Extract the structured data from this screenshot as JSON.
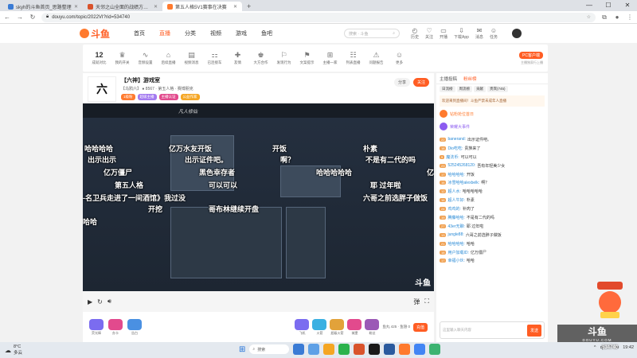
{
  "browser": {
    "tabs": [
      {
        "title": "skyh的斗鱼首页_思路整理",
        "color": "#3a7bd5",
        "active": false
      },
      {
        "title": "天邻之山全面的战绩方一套 企",
        "color": "#d9532c",
        "active": false
      },
      {
        "title": "第五人格5V1赛事在决赛",
        "color": "#ff7a2e",
        "active": true
      }
    ],
    "new_tab": "+",
    "url": "douyu.com/topic/2022VI?rid=534740",
    "controls": [
      "—",
      "☐",
      "✕"
    ]
  },
  "site": {
    "logo": "斗鱼",
    "nav": [
      {
        "label": "首页",
        "active": false
      },
      {
        "label": "直播",
        "active": true
      },
      {
        "label": "分类",
        "active": false
      },
      {
        "label": "视频",
        "active": false
      },
      {
        "label": "游戏",
        "active": false
      },
      {
        "label": "鱼吧",
        "active": false
      }
    ],
    "search_placeholder": "搜索 · 斗鱼",
    "top_icons": [
      {
        "icon": "◴",
        "label": "历史"
      },
      {
        "icon": "♡",
        "label": "关注"
      },
      {
        "icon": "▭",
        "label": "开播"
      },
      {
        "icon": "⇩",
        "label": "下载App"
      },
      {
        "icon": "✉",
        "label": "消息"
      },
      {
        "icon": "☺",
        "label": "任务"
      }
    ]
  },
  "toolrow": {
    "items": [
      {
        "icon": "12",
        "label": "成就对比"
      },
      {
        "icon": "♛",
        "label": "我的开关"
      },
      {
        "icon": "∿",
        "label": "音频设置"
      },
      {
        "icon": "⌂",
        "label": "后续直播"
      },
      {
        "icon": "▤",
        "label": "视频消息"
      },
      {
        "icon": "⚏",
        "label": "已连接车"
      },
      {
        "icon": "✚",
        "label": "友情"
      },
      {
        "icon": "♚",
        "label": "大方合作"
      },
      {
        "icon": "⚐",
        "label": "发现行为"
      },
      {
        "icon": "⚑",
        "label": "文案提示"
      },
      {
        "icon": "⊞",
        "label": "主播一家"
      },
      {
        "icon": "☷",
        "label": "列表直播"
      },
      {
        "icon": "⚠",
        "label": "问题报告"
      },
      {
        "icon": "☺",
        "label": "更多"
      }
    ],
    "pc_button": "PC客户端",
    "pc_sub": "主播独家行上播"
  },
  "room": {
    "logo": "六",
    "title": "【六神】游戏室",
    "sub": "【乌鸦六】 ● 8567 · 第五人格 · 赛博朋克",
    "tags": [
      {
        "label": "1级粉",
        "color": "#ff7a2e"
      },
      {
        "label": "超级主播",
        "color": "#a37af0"
      },
      {
        "label": "主播认证",
        "color": "#e24a8d"
      },
      {
        "label": "公益作家",
        "color": "#f5a623"
      }
    ],
    "share": "分享",
    "follow": "关注"
  },
  "video": {
    "steam_logo": "凡人修仙",
    "watermark": "斗鱼",
    "danmaku": [
      "哈哈哈哈",
      "亿万水友开饭",
      "开饭",
      "朴素",
      "出示出示",
      "出示证件吧。",
      "啊？",
      "不是有二代的吗",
      "亿万僵尸",
      "黑色幸存者",
      "哈哈哈哈哈",
      "亿",
      "第五人格",
      "可以可以",
      "耶 过年啦",
      "-名卫兵走进了一间酒馆》我过没",
      "六哥之前选胖子做饭",
      "开挖",
      "哥布林继续开盘",
      "哈哈"
    ]
  },
  "gifts": {
    "items": [
      {
        "label": "荧光棒",
        "color": "#7b6cf0"
      },
      {
        "label": "办卡",
        "color": "#e24a8d"
      },
      {
        "label": "告白",
        "color": "#4a90e2"
      }
    ],
    "right_items": [
      {
        "label": "飞机",
        "color": "#7b6cf0"
      },
      {
        "label": "火箭",
        "color": "#3ab0e2"
      },
      {
        "label": "超级火箭",
        "color": "#e2a23a"
      },
      {
        "label": "城堡",
        "color": "#e24a8d"
      },
      {
        "label": "粉丝",
        "color": "#9b59b6"
      }
    ],
    "balance": "鱼丸 425 · 鱼翅 0",
    "recharge": "充值"
  },
  "chat": {
    "header": [
      {
        "label": "主播投稿",
        "active": false
      },
      {
        "label": "粉丝榜",
        "active": true
      }
    ],
    "tabs": [
      "日流榜",
      "周流榜",
      "贡献",
      "贵宾(745)"
    ],
    "notice": "欢迎来到直播间！斗鱼严禁未成年人直播",
    "promo": [
      {
        "label": "钻粉抢位首日",
        "color": "#ff7a2e"
      },
      {
        "label": "荣耀大事件",
        "color": "#8c5cf0"
      }
    ],
    "messages": [
      {
        "lv": "22",
        "user": "banerand:",
        "text": "出示证件吧。"
      },
      {
        "lv": "18",
        "user": "Dio吃吃:",
        "text": "贵族来了"
      },
      {
        "lv": "9",
        "user": "魔法币:",
        "text": "可以可以"
      },
      {
        "lv": "23",
        "user": "525245268120:",
        "text": "吾有年轻美少女"
      },
      {
        "lv": "17",
        "user": "哈哈哈哈:",
        "text": "开饭"
      },
      {
        "lv": "16",
        "user": "冰雪哈哈alexbelk:",
        "text": "啊？"
      },
      {
        "lv": "12",
        "user": "超人水:",
        "text": "哈哈哈哈哈"
      },
      {
        "lv": "16",
        "user": "超人牛好:",
        "text": "朴素"
      },
      {
        "lv": "24",
        "user": "鸡鸡的:",
        "text": "补肉了"
      },
      {
        "lv": "19",
        "user": "腾藤哈哈:",
        "text": "不是有二代的吗"
      },
      {
        "lv": "27",
        "user": "43er无聊:",
        "text": "耶 过年啦"
      },
      {
        "lv": "13",
        "user": "jungle88:",
        "text": "六哥之前选胖子做饭"
      },
      {
        "lv": "21",
        "user": "哈哈哈哈:",
        "text": "哈哈"
      },
      {
        "lv": "18",
        "user": "用户加载ID:",
        "text": "亿万僵尸"
      },
      {
        "lv": "17",
        "user": "幸福小伙:",
        "text": "哈哈"
      }
    ],
    "input_placeholder": "这里输入聊天内容",
    "send": "发送"
  },
  "brand": {
    "name": "斗鱼",
    "url": "DOUYU.COM",
    "room_number": "534740"
  },
  "taskbar": {
    "weather_temp": "8°C",
    "weather_desc": "多云",
    "search": "搜索",
    "apps": [
      "#3a7bd5",
      "#5ea0e6",
      "#f5a623",
      "#2bb24c",
      "#d9532c",
      "#1a1a1a",
      "#2b5a9e",
      "#ff7a2e",
      "#4285f4",
      "#3cb371"
    ],
    "tray_lang": "中",
    "time": "19:42"
  }
}
